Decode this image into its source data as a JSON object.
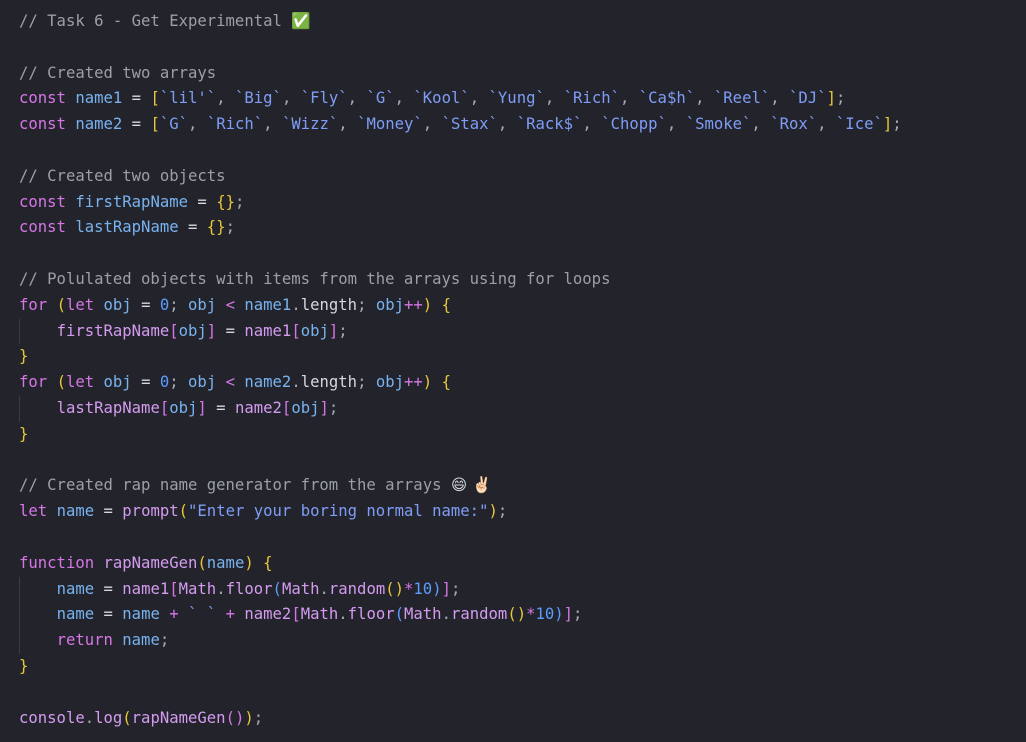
{
  "editor": {
    "lines": [
      [
        {
          "t": "// Task 6 - Get Experimental ",
          "c": "cmt"
        },
        {
          "t": "✅",
          "c": "emoji"
        }
      ],
      [],
      [
        {
          "t": "// Created two arrays",
          "c": "cmt"
        }
      ],
      [
        {
          "t": "const ",
          "c": "kw"
        },
        {
          "t": "name1",
          "c": "var"
        },
        {
          "t": " = ",
          "c": "def"
        },
        {
          "t": "[",
          "c": "brk1"
        },
        {
          "t": "`lil'`",
          "c": "str"
        },
        {
          "t": ", ",
          "c": "punc"
        },
        {
          "t": "`Big`",
          "c": "str"
        },
        {
          "t": ", ",
          "c": "punc"
        },
        {
          "t": "`Fly`",
          "c": "str"
        },
        {
          "t": ", ",
          "c": "punc"
        },
        {
          "t": "`G`",
          "c": "str"
        },
        {
          "t": ", ",
          "c": "punc"
        },
        {
          "t": "`Kool`",
          "c": "str"
        },
        {
          "t": ", ",
          "c": "punc"
        },
        {
          "t": "`Yung`",
          "c": "str"
        },
        {
          "t": ", ",
          "c": "punc"
        },
        {
          "t": "`Rich`",
          "c": "str"
        },
        {
          "t": ", ",
          "c": "punc"
        },
        {
          "t": "`Ca$h`",
          "c": "str"
        },
        {
          "t": ", ",
          "c": "punc"
        },
        {
          "t": "`Reel`",
          "c": "str"
        },
        {
          "t": ", ",
          "c": "punc"
        },
        {
          "t": "`DJ`",
          "c": "str"
        },
        {
          "t": "]",
          "c": "brk1"
        },
        {
          "t": ";",
          "c": "punc"
        }
      ],
      [
        {
          "t": "const ",
          "c": "kw"
        },
        {
          "t": "name2",
          "c": "var"
        },
        {
          "t": " = ",
          "c": "def"
        },
        {
          "t": "[",
          "c": "brk1"
        },
        {
          "t": "`G`",
          "c": "str"
        },
        {
          "t": ", ",
          "c": "punc"
        },
        {
          "t": "`Rich`",
          "c": "str"
        },
        {
          "t": ", ",
          "c": "punc"
        },
        {
          "t": "`Wizz`",
          "c": "str"
        },
        {
          "t": ", ",
          "c": "punc"
        },
        {
          "t": "`Money`",
          "c": "str"
        },
        {
          "t": ", ",
          "c": "punc"
        },
        {
          "t": "`Stax`",
          "c": "str"
        },
        {
          "t": ", ",
          "c": "punc"
        },
        {
          "t": "`Rack$`",
          "c": "str"
        },
        {
          "t": ", ",
          "c": "punc"
        },
        {
          "t": "`Chopp`",
          "c": "str"
        },
        {
          "t": ", ",
          "c": "punc"
        },
        {
          "t": "`Smoke`",
          "c": "str"
        },
        {
          "t": ", ",
          "c": "punc"
        },
        {
          "t": "`Rox`",
          "c": "str"
        },
        {
          "t": ", ",
          "c": "punc"
        },
        {
          "t": "`Ice`",
          "c": "str"
        },
        {
          "t": "]",
          "c": "brk1"
        },
        {
          "t": ";",
          "c": "punc"
        }
      ],
      [],
      [
        {
          "t": "// Created two objects",
          "c": "cmt"
        }
      ],
      [
        {
          "t": "const ",
          "c": "kw"
        },
        {
          "t": "firstRapName",
          "c": "var"
        },
        {
          "t": " = ",
          "c": "def"
        },
        {
          "t": "{}",
          "c": "brk1"
        },
        {
          "t": ";",
          "c": "punc"
        }
      ],
      [
        {
          "t": "const ",
          "c": "kw"
        },
        {
          "t": "lastRapName",
          "c": "var"
        },
        {
          "t": " = ",
          "c": "def"
        },
        {
          "t": "{}",
          "c": "brk1"
        },
        {
          "t": ";",
          "c": "punc"
        }
      ],
      [],
      [
        {
          "t": "// Polulated objects with items from the arrays using for loops",
          "c": "cmt"
        }
      ],
      [
        {
          "t": "for ",
          "c": "kw"
        },
        {
          "t": "(",
          "c": "brk1"
        },
        {
          "t": "let ",
          "c": "kw"
        },
        {
          "t": "obj",
          "c": "var"
        },
        {
          "t": " = ",
          "c": "def"
        },
        {
          "t": "0",
          "c": "num"
        },
        {
          "t": "; ",
          "c": "punc"
        },
        {
          "t": "obj",
          "c": "var"
        },
        {
          "t": " < ",
          "c": "op"
        },
        {
          "t": "name1",
          "c": "var"
        },
        {
          "t": ".",
          "c": "punc"
        },
        {
          "t": "length",
          "c": "prop"
        },
        {
          "t": "; ",
          "c": "punc"
        },
        {
          "t": "obj",
          "c": "var"
        },
        {
          "t": "++",
          "c": "op"
        },
        {
          "t": ") ",
          "c": "brk1"
        },
        {
          "t": "{",
          "c": "brk1"
        }
      ],
      [
        {
          "t": "    ",
          "c": "def",
          "g": 1
        },
        {
          "t": "firstRapName",
          "c": "fn"
        },
        {
          "t": "[",
          "c": "brk2"
        },
        {
          "t": "obj",
          "c": "var"
        },
        {
          "t": "]",
          "c": "brk2"
        },
        {
          "t": " = ",
          "c": "def"
        },
        {
          "t": "name1",
          "c": "fn"
        },
        {
          "t": "[",
          "c": "brk2"
        },
        {
          "t": "obj",
          "c": "var"
        },
        {
          "t": "]",
          "c": "brk2"
        },
        {
          "t": ";",
          "c": "punc"
        }
      ],
      [
        {
          "t": "}",
          "c": "brk1"
        }
      ],
      [
        {
          "t": "for ",
          "c": "kw"
        },
        {
          "t": "(",
          "c": "brk1"
        },
        {
          "t": "let ",
          "c": "kw"
        },
        {
          "t": "obj",
          "c": "var"
        },
        {
          "t": " = ",
          "c": "def"
        },
        {
          "t": "0",
          "c": "num"
        },
        {
          "t": "; ",
          "c": "punc"
        },
        {
          "t": "obj",
          "c": "var"
        },
        {
          "t": " < ",
          "c": "op"
        },
        {
          "t": "name2",
          "c": "var"
        },
        {
          "t": ".",
          "c": "punc"
        },
        {
          "t": "length",
          "c": "prop"
        },
        {
          "t": "; ",
          "c": "punc"
        },
        {
          "t": "obj",
          "c": "var"
        },
        {
          "t": "++",
          "c": "op"
        },
        {
          "t": ") ",
          "c": "brk1"
        },
        {
          "t": "{",
          "c": "brk1"
        }
      ],
      [
        {
          "t": "    ",
          "c": "def",
          "g": 1
        },
        {
          "t": "lastRapName",
          "c": "fn"
        },
        {
          "t": "[",
          "c": "brk2"
        },
        {
          "t": "obj",
          "c": "var"
        },
        {
          "t": "]",
          "c": "brk2"
        },
        {
          "t": " = ",
          "c": "def"
        },
        {
          "t": "name2",
          "c": "fn"
        },
        {
          "t": "[",
          "c": "brk2"
        },
        {
          "t": "obj",
          "c": "var"
        },
        {
          "t": "]",
          "c": "brk2"
        },
        {
          "t": ";",
          "c": "punc"
        }
      ],
      [
        {
          "t": "}",
          "c": "brk1"
        }
      ],
      [],
      [
        {
          "t": "// Created rap name generator from the arrays ",
          "c": "cmt"
        },
        {
          "t": "😄 ✌🏻",
          "c": "emoji"
        }
      ],
      [
        {
          "t": "let ",
          "c": "kw"
        },
        {
          "t": "name",
          "c": "var"
        },
        {
          "t": " = ",
          "c": "def"
        },
        {
          "t": "prompt",
          "c": "fn"
        },
        {
          "t": "(",
          "c": "brk1"
        },
        {
          "t": "\"Enter your boring normal name:\"",
          "c": "str"
        },
        {
          "t": ")",
          "c": "brk1"
        },
        {
          "t": ";",
          "c": "punc"
        }
      ],
      [],
      [
        {
          "t": "function ",
          "c": "kw"
        },
        {
          "t": "rapNameGen",
          "c": "fn"
        },
        {
          "t": "(",
          "c": "brk1"
        },
        {
          "t": "name",
          "c": "var"
        },
        {
          "t": ") ",
          "c": "brk1"
        },
        {
          "t": "{",
          "c": "brk1"
        }
      ],
      [
        {
          "t": "    ",
          "c": "def",
          "g": 1
        },
        {
          "t": "name",
          "c": "var"
        },
        {
          "t": " = ",
          "c": "def"
        },
        {
          "t": "name1",
          "c": "fn"
        },
        {
          "t": "[",
          "c": "brk2"
        },
        {
          "t": "Math",
          "c": "fn"
        },
        {
          "t": ".",
          "c": "punc"
        },
        {
          "t": "floor",
          "c": "fn"
        },
        {
          "t": "(",
          "c": "brk3"
        },
        {
          "t": "Math",
          "c": "fn"
        },
        {
          "t": ".",
          "c": "punc"
        },
        {
          "t": "random",
          "c": "fn"
        },
        {
          "t": "()",
          "c": "brk1"
        },
        {
          "t": "*",
          "c": "op"
        },
        {
          "t": "10",
          "c": "num"
        },
        {
          "t": ")",
          "c": "brk3"
        },
        {
          "t": "]",
          "c": "brk2"
        },
        {
          "t": ";",
          "c": "punc"
        }
      ],
      [
        {
          "t": "    ",
          "c": "def",
          "g": 1
        },
        {
          "t": "name",
          "c": "var"
        },
        {
          "t": " = ",
          "c": "def"
        },
        {
          "t": "name",
          "c": "var"
        },
        {
          "t": " + ",
          "c": "op"
        },
        {
          "t": "` `",
          "c": "str"
        },
        {
          "t": " + ",
          "c": "op"
        },
        {
          "t": "name2",
          "c": "fn"
        },
        {
          "t": "[",
          "c": "brk2"
        },
        {
          "t": "Math",
          "c": "fn"
        },
        {
          "t": ".",
          "c": "punc"
        },
        {
          "t": "floor",
          "c": "fn"
        },
        {
          "t": "(",
          "c": "brk3"
        },
        {
          "t": "Math",
          "c": "fn"
        },
        {
          "t": ".",
          "c": "punc"
        },
        {
          "t": "random",
          "c": "fn"
        },
        {
          "t": "()",
          "c": "brk1"
        },
        {
          "t": "*",
          "c": "op"
        },
        {
          "t": "10",
          "c": "num"
        },
        {
          "t": ")",
          "c": "brk3"
        },
        {
          "t": "]",
          "c": "brk2"
        },
        {
          "t": ";",
          "c": "punc"
        }
      ],
      [
        {
          "t": "    ",
          "c": "def",
          "g": 1
        },
        {
          "t": "return ",
          "c": "kw"
        },
        {
          "t": "name",
          "c": "var"
        },
        {
          "t": ";",
          "c": "punc"
        }
      ],
      [
        {
          "t": "}",
          "c": "brk1"
        }
      ],
      [],
      [
        {
          "t": "console",
          "c": "fn"
        },
        {
          "t": ".",
          "c": "punc"
        },
        {
          "t": "log",
          "c": "fn"
        },
        {
          "t": "(",
          "c": "brk1"
        },
        {
          "t": "rapNameGen",
          "c": "fn"
        },
        {
          "t": "()",
          "c": "brk2"
        },
        {
          "t": ")",
          "c": "brk1"
        },
        {
          "t": ";",
          "c": "punc"
        }
      ]
    ]
  }
}
